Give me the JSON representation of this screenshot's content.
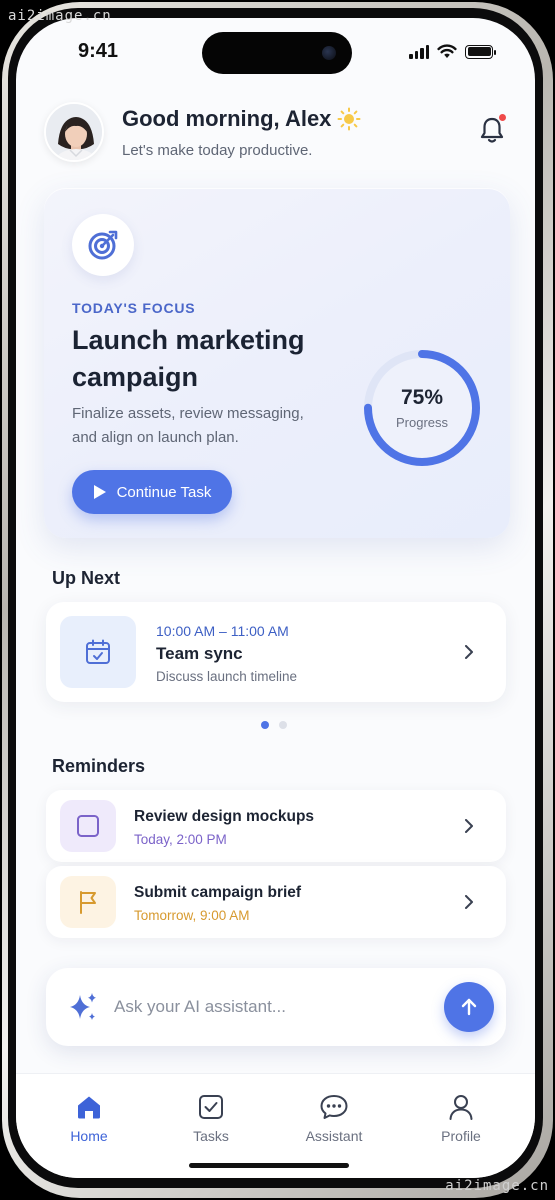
{
  "watermark": {
    "top": "ai2image.cn",
    "bottom": "ai2image.cn"
  },
  "status_bar": {
    "time": "9:41",
    "icons": [
      "signal-icon",
      "wifi-icon",
      "battery-icon"
    ]
  },
  "header": {
    "greeting": "Good morning, Alex",
    "greeting_icon": "sun-icon",
    "subtitle": "Let's make today productive.",
    "notification_icon": "bell-icon",
    "has_unread": true
  },
  "focus": {
    "label": "TODAY'S FOCUS",
    "title": "Launch marketing campaign",
    "description": "Finalize assets, review messaging, and align on launch plan.",
    "button_label": "Continue Task",
    "progress_value": "75%",
    "progress_fraction": 0.75,
    "progress_label": "Progress"
  },
  "up_next": {
    "title": "Up Next",
    "event": {
      "time": "10:00 AM – 11:00 AM",
      "title": "Team sync",
      "subtitle": "Discuss launch timeline"
    },
    "pager_count": 2,
    "pager_active": 0
  },
  "reminders": {
    "title": "Reminders",
    "items": [
      {
        "title": "Review design mockups",
        "time": "Today, 2:00 PM",
        "icon": "checkbox-icon",
        "accent": "#7b63c9",
        "icon_bg": "#efeafb"
      },
      {
        "title": "Submit campaign brief",
        "time": "Tomorrow, 9:00 AM",
        "icon": "flag-icon",
        "accent": "#d79a2f",
        "icon_bg": "#fdf3e3"
      }
    ]
  },
  "assistant": {
    "placeholder": "Ask your AI assistant...",
    "icon": "sparkle-icon",
    "send_icon": "arrow-up-icon"
  },
  "tabs": [
    {
      "label": "Home",
      "icon": "home-icon",
      "active": true
    },
    {
      "label": "Tasks",
      "icon": "checkbox-icon",
      "active": false
    },
    {
      "label": "Assistant",
      "icon": "chat-icon",
      "active": false
    },
    {
      "label": "Profile",
      "icon": "user-icon",
      "active": false
    }
  ],
  "colors": {
    "accent": "#4f74e6",
    "accent_dark": "#3d63d8",
    "alert": "#ef4a4a",
    "text": "#1d2433",
    "muted": "#6a7080"
  }
}
